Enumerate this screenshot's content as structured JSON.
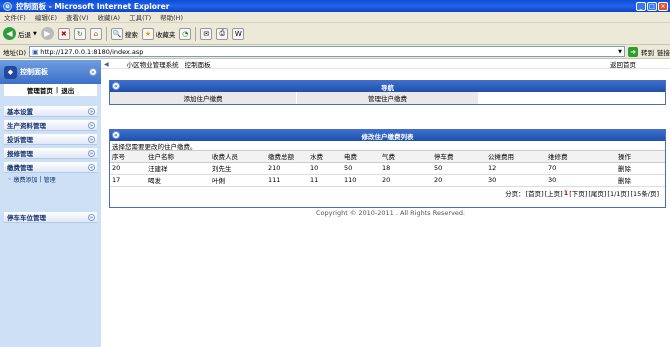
{
  "window": {
    "title": "控制面板 - Microsoft Internet Explorer"
  },
  "menu": [
    "文件(F)",
    "编辑(E)",
    "查看(V)",
    "收藏(A)",
    "工具(T)",
    "帮助(H)"
  ],
  "toolbar": {
    "back": "后退",
    "search": "搜索",
    "favorites": "收藏夹"
  },
  "address": {
    "label": "地址(D)",
    "url": "http://127.0.0.1:8180/index.asp",
    "go": "转到",
    "links": "链接"
  },
  "header": {
    "system": "小区物业管理系统",
    "panel": "控制面板",
    "recent": "返回首页"
  },
  "sidebar": {
    "logo": "控制面板",
    "top_links": [
      "管理首页",
      "退出"
    ],
    "sections": [
      "基本设置",
      "生产资料管理",
      "投诉管理",
      "报修管理",
      "缴费管理"
    ],
    "sub_links": [
      "缴费添加",
      "管理"
    ],
    "parking": "停车车位管理"
  },
  "nav_panel": {
    "title": "导航",
    "links": [
      "添加住户缴费",
      "管理住户缴费"
    ]
  },
  "list_panel": {
    "title": "修改住户缴费列表",
    "message": "选择您需要更改的住户缴费。",
    "columns": [
      "序号",
      "住户名称",
      "收费人员",
      "缴费总额",
      "水费",
      "电费",
      "气费",
      "停车费",
      "公摊费用",
      "维修费",
      "操作"
    ],
    "rows": [
      [
        "20",
        "汪建祥",
        "刘先生",
        "210",
        "10",
        "50",
        "18",
        "50",
        "12",
        "70",
        "删除"
      ],
      [
        "17",
        "喝发",
        "叶俐",
        "111",
        "11",
        "110",
        "20",
        "20",
        "30",
        "30",
        "删除"
      ]
    ],
    "pager": {
      "prefix": "分页：",
      "first": "[首页]",
      "prev": "[上页]",
      "current": "1",
      "next": "[下页]",
      "last": "[尾页]",
      "pages": "[1/1页]",
      "per_page": "[15条/页]"
    }
  },
  "footer": {
    "copyright": "Copyright © 2010-2011 . All Rights Reserved."
  }
}
